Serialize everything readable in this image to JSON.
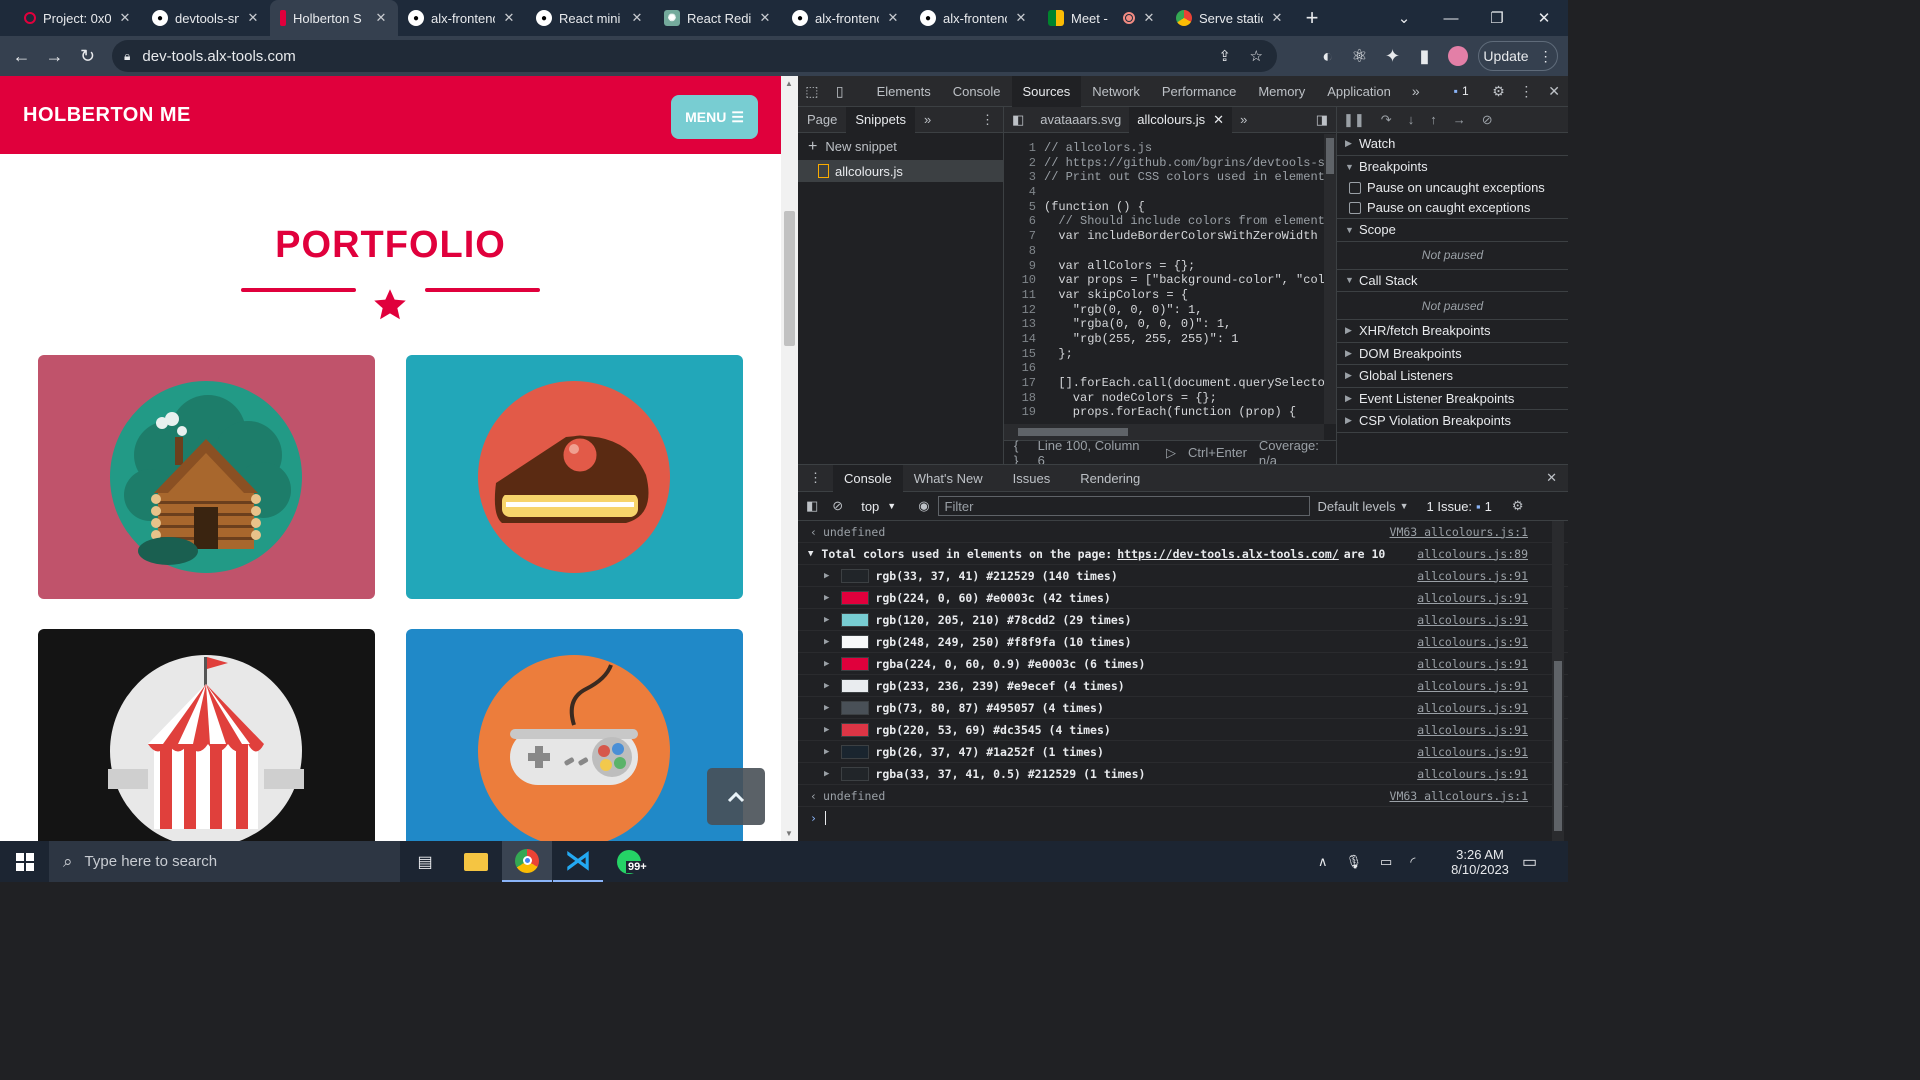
{
  "browser": {
    "tabs": [
      {
        "label": "Project: 0x0",
        "icon": "holberton-icon",
        "active": false
      },
      {
        "label": "devtools-sn",
        "icon": "github-icon",
        "active": false
      },
      {
        "label": "Holberton S",
        "icon": "holberton-icon",
        "active": true
      },
      {
        "label": "alx-frontenc",
        "icon": "github-icon",
        "active": false
      },
      {
        "label": "React mini l",
        "icon": "github-icon",
        "active": false
      },
      {
        "label": "React Redir",
        "icon": "chatgpt-icon",
        "active": false
      },
      {
        "label": "alx-frontenc",
        "icon": "github-icon",
        "active": false
      },
      {
        "label": "alx-frontenc",
        "icon": "github-icon",
        "active": false
      },
      {
        "label": "Meet -",
        "icon": "meet-icon",
        "active": false
      },
      {
        "label": "Serve static",
        "icon": "chrome-icon",
        "active": false
      }
    ],
    "url": "dev-tools.alx-tools.com",
    "update_label": "Update"
  },
  "site": {
    "brand": "HOLBERTON ME",
    "menu_label": "MENU",
    "portfolio_title": "PORTFOLIO",
    "colors": {
      "primary": "#e0003c",
      "accent": "#78cdd2"
    }
  },
  "devtools": {
    "main_tabs": [
      "Elements",
      "Console",
      "Sources",
      "Network",
      "Performance",
      "Memory",
      "Application"
    ],
    "active_main_tab": "Sources",
    "issues_badge": "1",
    "nav_tabs": [
      "Page",
      "Snippets"
    ],
    "new_snippet": "New snippet",
    "snippet_file": "allcolours.js",
    "editor_tabs": [
      "avataaars.svg",
      "allcolours.js"
    ],
    "code_lines": [
      "// allcolors.js",
      "// https://github.com/bgrins/devtools-sn",
      "// Print out CSS colors used in elements",
      "",
      "(function () {",
      "  // Should include colors from elements",
      "  var includeBorderColorsWithZeroWidth =",
      "",
      "  var allColors = {};",
      "  var props = [\"background-color\", \"colo",
      "  var skipColors = {",
      "    \"rgb(0, 0, 0)\": 1,",
      "    \"rgba(0, 0, 0, 0)\": 1,",
      "    \"rgb(255, 255, 255)\": 1",
      "  };",
      "",
      "  [].forEach.call(document.querySelector",
      "    var nodeColors = {};",
      "    props.forEach(function (prop) {"
    ],
    "status_position": "Line 100, Column 6",
    "status_run": "Ctrl+Enter",
    "status_coverage": "Coverage: n/a",
    "debugger": {
      "watch": "Watch",
      "breakpoints": "Breakpoints",
      "pause_uncaught": "Pause on uncaught exceptions",
      "pause_caught": "Pause on caught exceptions",
      "scope": "Scope",
      "not_paused_1": "Not paused",
      "call_stack": "Call Stack",
      "not_paused_2": "Not paused",
      "xhr": "XHR/fetch Breakpoints",
      "dom": "DOM Breakpoints",
      "global": "Global Listeners",
      "event": "Event Listener Breakpoints",
      "csp": "CSP Violation Breakpoints"
    },
    "drawer_tabs": [
      "Console",
      "What's New",
      "Issues",
      "Rendering"
    ],
    "console_context": "top",
    "filter_placeholder": "Filter",
    "levels": "Default levels",
    "issues_label": "1 Issue:",
    "issues_count": "1",
    "console": {
      "undefined_1": "undefined",
      "undefined_1_src": "VM63 allcolours.js:1",
      "summary_prefix": "Total colors used in elements on the page: ",
      "summary_link": "https://dev-tools.alx-tools.com/",
      "summary_suffix": " are 10",
      "summary_src": "allcolours.js:89",
      "entries": [
        {
          "text": "rgb(33, 37, 41) #212529 (140 times)",
          "color": "#212529",
          "src": "allcolours.js:91"
        },
        {
          "text": "rgb(224, 0, 60) #e0003c (42 times)",
          "color": "#e0003c",
          "src": "allcolours.js:91"
        },
        {
          "text": "rgb(120, 205, 210) #78cdd2 (29 times)",
          "color": "#78cdd2",
          "src": "allcolours.js:91"
        },
        {
          "text": "rgb(248, 249, 250) #f8f9fa (10 times)",
          "color": "#f8f9fa",
          "src": "allcolours.js:91"
        },
        {
          "text": "rgba(224, 0, 60, 0.9) #e0003c (6 times)",
          "color": "#e0003c",
          "src": "allcolours.js:91"
        },
        {
          "text": "rgb(233, 236, 239) #e9ecef (4 times)",
          "color": "#e9ecef",
          "src": "allcolours.js:91"
        },
        {
          "text": "rgb(73, 80, 87) #495057 (4 times)",
          "color": "#495057",
          "src": "allcolours.js:91"
        },
        {
          "text": "rgb(220, 53, 69) #dc3545 (4 times)",
          "color": "#dc3545",
          "src": "allcolours.js:91"
        },
        {
          "text": "rgb(26, 37, 47) #1a252f (1 times)",
          "color": "#1a252f",
          "src": "allcolours.js:91"
        },
        {
          "text": "rgba(33, 37, 41, 0.5) #212529 (1 times)",
          "color": "#212529",
          "src": "allcolours.js:91"
        }
      ],
      "undefined_2": "undefined",
      "undefined_2_src": "VM63 allcolours.js:1"
    }
  },
  "taskbar": {
    "search_placeholder": "Type here to search",
    "whatsapp_badge": "99+",
    "time": "3:26 AM",
    "date": "8/10/2023"
  }
}
